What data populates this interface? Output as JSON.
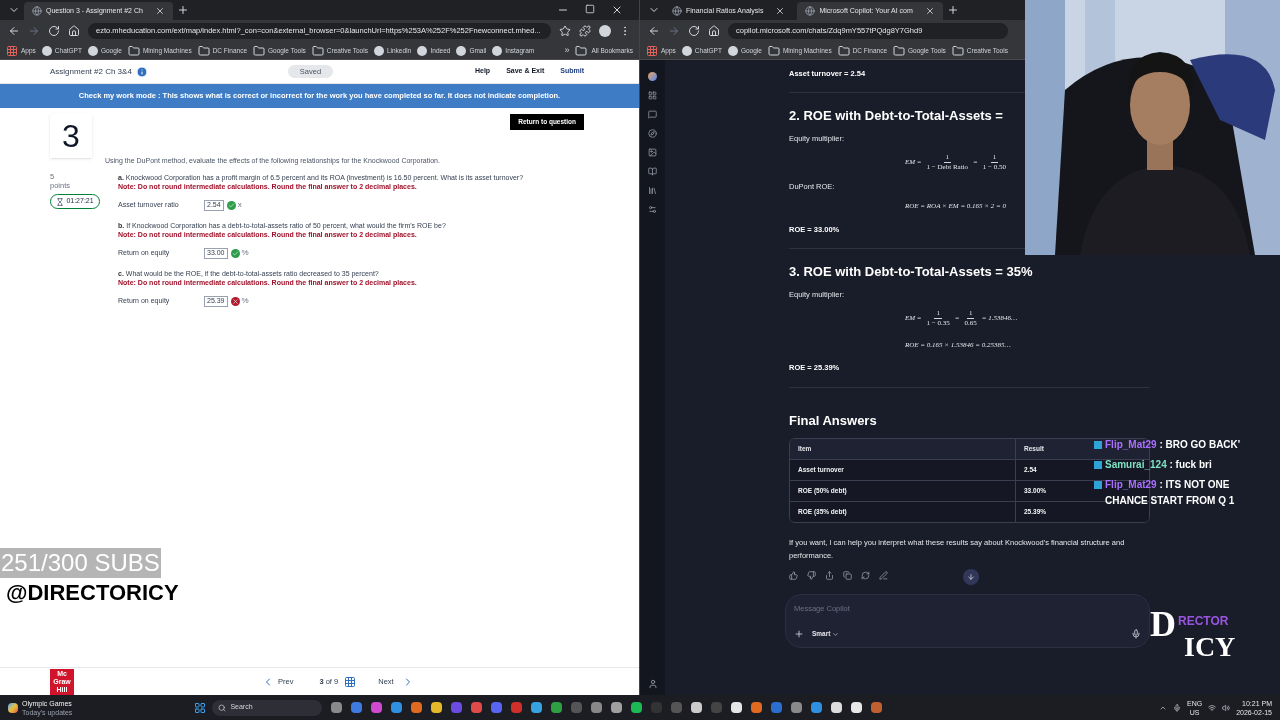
{
  "left_browser": {
    "tabs": [
      {
        "title": "Question 3 - Assignment #2 Ch",
        "selected": true
      }
    ],
    "url": "ezto.mheducation.com/ext/map/index.html?_con=con&external_browser=0&launchUrl=https%253A%252F%252Fnewconnect.mhed...",
    "bookmarks": [
      {
        "kind": "apps",
        "label": "Apps"
      },
      {
        "kind": "site",
        "label": "ChatGPT"
      },
      {
        "kind": "site",
        "label": "Google"
      },
      {
        "kind": "folder",
        "label": "Mining Machines"
      },
      {
        "kind": "folder",
        "label": "DC Finance"
      },
      {
        "kind": "folder",
        "label": "Google Tools"
      },
      {
        "kind": "folder",
        "label": "Creative Tools"
      },
      {
        "kind": "site",
        "label": "LinkedIn"
      },
      {
        "kind": "site",
        "label": "Indeed"
      },
      {
        "kind": "site",
        "label": "Gmail"
      },
      {
        "kind": "site",
        "label": "Instagram"
      }
    ],
    "more": "»",
    "all_bookmarks": "All Bookmarks"
  },
  "assignment": {
    "title": "Assignment #2 Ch 3&4",
    "saved": "Saved",
    "nav": [
      "Help",
      "Save & Exit",
      "Submit"
    ],
    "banner": "Check my work mode : This shows what is correct or incorrect for the work you have completed so far. It does not indicate completion.",
    "return_button": "Return to question",
    "number": "3",
    "points": "5",
    "points_label": "points",
    "timer": "01:27:21",
    "intro": "Using the DuPont method, evaluate the effects of the following relationships for the Knockwood Corporation.",
    "parts": [
      {
        "letter": "a.",
        "question": "Knockwood Corporation has a profit margin of 6.5 percent and its ROA (investment) is 16.50 percent. What is its asset turnover?",
        "note": "Note: Do not round intermediate calculations. Round the final answer to 2 decimal places.",
        "label": "Asset turnover ratio",
        "value": "2.54",
        "correct": true,
        "unit": "x"
      },
      {
        "letter": "b.",
        "question": "If Knockwood Corporation has a debt-to-total-assets ratio of 50 percent, what would the firm's ROE be?",
        "note": "Note: Do not round intermediate calculations. Round the final answer to 2 decimal places.",
        "label": "Return on equity",
        "value": "33.00",
        "correct": true,
        "unit": "%"
      },
      {
        "letter": "c.",
        "question": "What would be the ROE, if the debt-to-total-assets ratio decreased to 35 percent?",
        "note": "Note: Do not round intermediate calculations. Round the final answer to 2 decimal places.",
        "label": "Return on equity",
        "value": "25.39",
        "correct": false,
        "unit": "%"
      }
    ],
    "logo": [
      "Mc",
      "Graw",
      "Hill"
    ],
    "footer": {
      "prev": "Prev",
      "page": "3",
      "of": "of",
      "total": "9",
      "next": "Next"
    }
  },
  "right_browser": {
    "tabs": [
      {
        "title": "Financial Ratios Analysis",
        "selected": false
      },
      {
        "title": "Microsoft Copilot: Your AI com",
        "selected": true
      }
    ],
    "url": "copilot.microsoft.com/chats/Zdq9mY557tPQdg8Y7Ghd9",
    "bookmarks": [
      {
        "kind": "apps",
        "label": "Apps"
      },
      {
        "kind": "site",
        "label": "ChatGPT"
      },
      {
        "kind": "site",
        "label": "Google"
      },
      {
        "kind": "folder",
        "label": "Mining Machines"
      },
      {
        "kind": "folder",
        "label": "DC Finance"
      },
      {
        "kind": "folder",
        "label": "Google Tools"
      },
      {
        "kind": "folder",
        "label": "Creative Tools"
      }
    ]
  },
  "copilot": {
    "blocks": [
      {
        "kind": "bold",
        "text": "Asset turnover = 2.54"
      },
      {
        "kind": "divider"
      },
      {
        "kind": "heading",
        "text": "2. ROE with Debt-to-Total-Assets ="
      },
      {
        "kind": "label",
        "text": "Equity multiplier:"
      },
      {
        "kind": "formula",
        "parts": [
          {
            "kind": "text",
            "text": "EM ="
          },
          {
            "kind": "frac",
            "num": "1",
            "den": "1 − Debt Ratio"
          },
          {
            "kind": "text",
            "text": "="
          },
          {
            "kind": "frac",
            "num": "1",
            "den": "1 − 0.50"
          }
        ]
      },
      {
        "kind": "label",
        "text": "DuPont ROE:"
      },
      {
        "kind": "formula",
        "parts": [
          {
            "kind": "text",
            "text": "ROE = ROA × EM = 0.165 × 2 = 0"
          }
        ]
      },
      {
        "kind": "bold",
        "text": "ROE = 33.00%"
      },
      {
        "kind": "divider"
      },
      {
        "kind": "heading",
        "text": "3. ROE with Debt-to-Total-Assets = 35%"
      },
      {
        "kind": "label",
        "text": "Equity multiplier:"
      },
      {
        "kind": "formula",
        "parts": [
          {
            "kind": "text",
            "text": "EM ="
          },
          {
            "kind": "frac",
            "num": "1",
            "den": "1 − 0.35"
          },
          {
            "kind": "text",
            "text": "="
          },
          {
            "kind": "frac",
            "num": "1",
            "den": "0.65"
          },
          {
            "kind": "text",
            "text": "= 1.53846…"
          }
        ]
      },
      {
        "kind": "formula",
        "parts": [
          {
            "kind": "text",
            "text": "ROE = 0.165 × 1.53846 = 0.25385…"
          }
        ]
      },
      {
        "kind": "bold",
        "text": "ROE = 25.39%"
      },
      {
        "kind": "divider"
      }
    ],
    "final_heading": "Final Answers",
    "table": {
      "columns": [
        "Item",
        "Result"
      ],
      "rows": [
        [
          "Asset turnover",
          "2.54"
        ],
        [
          "ROE (50% debt)",
          "33.00%"
        ],
        [
          "ROE (35% debt)",
          "25.39%"
        ]
      ]
    },
    "followup": "If you want, I can help you interpret what these results say about Knockwood's financial structure and performance.",
    "composer": {
      "placeholder": "Message Copilot",
      "mode": "Smart"
    }
  },
  "stream_chat": [
    {
      "user": "Flip_Mat29",
      "color": "#a970ff",
      "text": ": BRO GO BACK'"
    },
    {
      "user": "Samurai_124",
      "color": "#7fe3c4",
      "text": ": fuck bri"
    },
    {
      "user": "Flip_Mat29",
      "color": "#a970ff",
      "text": ": ITS NOT ONE CHANCE START FROM Q 1"
    }
  ],
  "subs_overlay": {
    "goal": "251/300 SUBS",
    "handle": "@DIRECTORICY"
  },
  "stream_logo": [
    "D",
    "RECTOR",
    "ICY"
  ],
  "taskbar": {
    "news_title": "Olympic Games",
    "news_sub": "Today's updates",
    "search": "Search",
    "lang": "ENG",
    "region": "US",
    "time": "10:21 PM",
    "date": "2026-02-15"
  }
}
